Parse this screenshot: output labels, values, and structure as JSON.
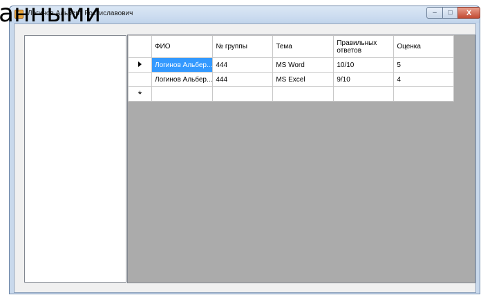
{
  "background_text": "анными",
  "window": {
    "title": "Логинов Альберт Ростиславович",
    "controls": {
      "minimize": "‒",
      "maximize": "□",
      "close": "X"
    }
  },
  "grid": {
    "columns": [
      "ФИО",
      "№ группы",
      "Тема",
      "Правильных ответов",
      "Оценка"
    ],
    "rows": [
      {
        "fio": "Логинов Альбер...",
        "group": "444",
        "topic": "MS Word",
        "correct": "10/10",
        "grade": "5",
        "current": true
      },
      {
        "fio": "Логинов Альбер...",
        "group": "444",
        "topic": "MS Excel",
        "correct": "9/10",
        "grade": "4",
        "current": false
      }
    ],
    "new_row_marker": "*"
  },
  "colors": {
    "selection": "#3399ff",
    "grid_background": "#ababab"
  }
}
